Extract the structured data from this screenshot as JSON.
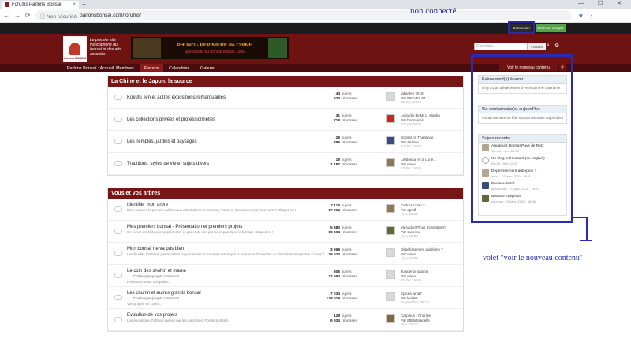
{
  "browser": {
    "tab_title": "Forums Parlons Bonsaï",
    "tab_close": "×",
    "new_tab": "+",
    "window_controls": "— ☐ ✕",
    "back": "←",
    "forward": "→",
    "reload": "⟳",
    "security": "ⓘ Non sécurisé",
    "url": "parlonsbonsai.com/forums/",
    "star": "★",
    "menu": "⋮"
  },
  "annotations": {
    "top_label": "non connecté",
    "side_label": "volet \"voir le nouveau contenu\""
  },
  "topbar": {
    "login": "Connexion",
    "create": "Créer un compte"
  },
  "header": {
    "tagline": "Le premier site francophone du bonsaï et des arts associés",
    "logo_text": "Parlons BONSAÏ",
    "banner_title": "PHUNG - PEPINIERE de CHINE",
    "banner_sub": "Spécialiste du bonsaï depuis 1986",
    "search_placeholder": "Chercher...",
    "search_scope": "Forums",
    "search_icon": "search-icon",
    "settings_icon": "gear-icon"
  },
  "nav": {
    "items": [
      "Parlons Bonsaï : Accueil",
      "Membres",
      "Forums",
      "Calendrier",
      "Galerie"
    ]
  },
  "sections": [
    {
      "title": "La Chine et le Japon, la source",
      "rows": [
        {
          "title": "Kokufu Ten et autres expositions remarquables",
          "subjects": "44",
          "replies": "520",
          "last_title": "takanten 2019",
          "last_by": "Par MICHEL 87",
          "last_date": "16 déc. 2019"
        },
        {
          "title": "Les collections privées et professionnelles",
          "subjects": "31",
          "replies": "718",
          "last_title": "Le jardin de Mr Li Xiaobo",
          "last_by": "Par bonsaiphil",
          "last_date": "27 avril 2019"
        },
        {
          "title": "Les Temples, jardins et paysages",
          "subjects": "29",
          "replies": "796",
          "last_title": "Bonsaï en Thaïlande",
          "last_by": "Par aristide",
          "last_date": "24 déc. 2019"
        },
        {
          "title": "Traditions, styles de vie et sujets divers",
          "subjects": "19",
          "replies": "1 187",
          "last_title": "Le Bonsaï et la Lune...",
          "last_by": "Par waoo",
          "last_date": "13 déc. 2019"
        }
      ]
    },
    {
      "title": "Vous et vos arbres",
      "rows": [
        {
          "title": "Identifier mon arbre",
          "desc": "Bien souvent le premier arbre nous est totalement inconnu. Vous ne connaissez pas son nom ? Cliquez ici !",
          "subjects": "2 116",
          "replies": "17 313",
          "last_title": "Cedrus Liban ?",
          "last_by": "Par dpmff",
          "last_date": "Hier, 18:11"
        },
        {
          "title": "Mes premiers bonsaï - Présentation et premiers projets",
          "desc": "Ce forum est fait pour se présenter et parler de vos premiers pas dans le bonsaï. Cliquez ici !",
          "subjects": "5 880",
          "replies": "68 694",
          "last_title": "Yamadori Pinus Sylvestris #1",
          "last_by": "Par Gwenru",
          "last_date": "Hier, 16:28"
        },
        {
          "title": "Mon bonsaï ne va pas bien",
          "desc": "Les feuilles tombent, pendouillent ou jaunissent, vous avez remarqué la présence d'insectes ou de taches suspectes ? Vous êtes inquiet, paniqué, parlons-en ici !",
          "subjects": "3 968",
          "replies": "39 524",
          "last_title": "Dépérissement aubépine ?",
          "last_by": "Par waoo",
          "last_date": "Hier, 17:03"
        },
        {
          "title": "Le coin des shohin et mame",
          "sub": "Challenges-projets communs",
          "desc": "Présentez-nous vos petits...",
          "subjects": "805",
          "replies": "22 564",
          "last_title": "Juniperus sabina",
          "last_by": "Par waoo",
          "last_date": "31 déc. 2019"
        },
        {
          "title": "Les chuhin et autres grands bonsaï",
          "sub": "Challenges-projets communs",
          "desc": "Vos projets en cours...",
          "subjects": "7 034",
          "replies": "128 019",
          "last_title": "Épicéa wind?",
          "last_by": "Par kiob68",
          "last_date": "Aujourd'hui, 09:12"
        },
        {
          "title": "Evolution de vos projets",
          "desc": "Les évolutions d'arbres suivies par les membres. Forum protégé.",
          "subjects": "128",
          "replies": "9 934",
          "last_title": "Carpinus - Charme",
          "last_by": "Par MBdeMaigelle",
          "last_date": "Hier, 19:10"
        }
      ]
    }
  ],
  "labels": {
    "subjects": "sujets",
    "replies": "réponses"
  },
  "sidebar": {
    "new_content": "Voir le nouveau contenu",
    "pin_icon": "map-pin-icon",
    "events_title": "Évènement(s) à venir",
    "events_body": "Il n'y a pas d'évènement à venir dans le calendrier",
    "bday_title": "%s anniversaire(s) aujourd'hui",
    "bday_body": "Aucun membre ne fête son anniversaire aujourd'hui",
    "recent_title": "Sujets récents",
    "recent": [
      {
        "title": "Amateurs Bonsaï Pays de Retz",
        "meta": "Tom44 - Hier, 21:55"
      },
      {
        "title": "Un blog intéressant (en anglais)",
        "meta": "him75 - Hier, 11:33"
      },
      {
        "title": "Dépérissement aubépine ?",
        "meta": "waoo - 03 janv. 2020 - 18:31"
      },
      {
        "title": "Bouleau lettré",
        "meta": "sylvodontis - 03 janv. 2020 - 16:17"
      },
      {
        "title": "Bouture juniperus",
        "meta": "chuchao - 02 janv. 2020 - 18:36"
      }
    ]
  }
}
